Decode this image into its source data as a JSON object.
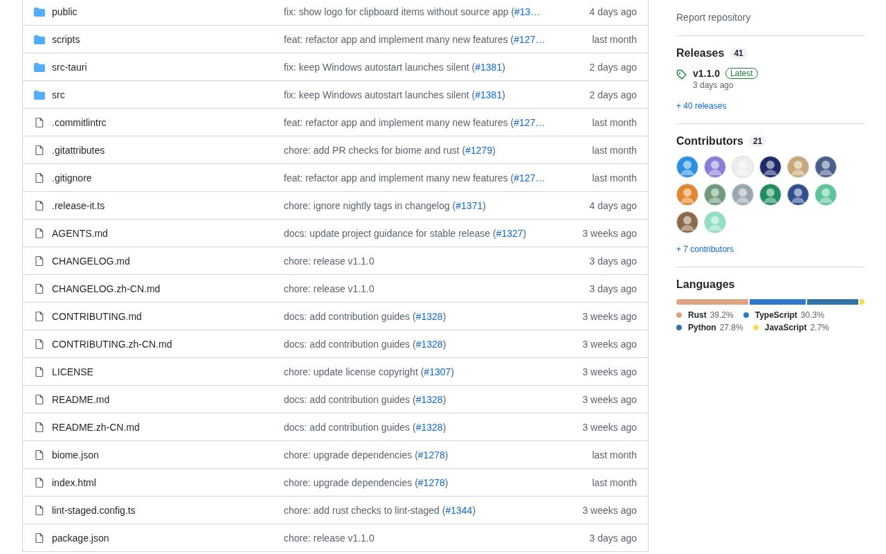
{
  "files": [
    {
      "kind": "folder",
      "name": "public",
      "msg": "fix: show logo for clipboard items without source app (",
      "pr": "#13…",
      "time": "4 days ago"
    },
    {
      "kind": "folder",
      "name": "scripts",
      "msg": "feat: refactor app and implement many new features (",
      "pr": "#127…",
      "time": "last month"
    },
    {
      "kind": "folder",
      "name": "src-tauri",
      "msg": "fix: keep Windows autostart launches silent (",
      "pr": "#1381",
      "tail": ")",
      "time": "2 days ago"
    },
    {
      "kind": "folder",
      "name": "src",
      "msg": "fix: keep Windows autostart launches silent (",
      "pr": "#1381",
      "tail": ")",
      "time": "2 days ago"
    },
    {
      "kind": "file",
      "name": ".commitlintrc",
      "msg": "feat: refactor app and implement many new features (",
      "pr": "#127…",
      "time": "last month"
    },
    {
      "kind": "file",
      "name": ".gitattributes",
      "msg": "chore: add PR checks for biome and rust (",
      "pr": "#1279",
      "tail": ")",
      "time": "last month"
    },
    {
      "kind": "file",
      "name": ".gitignore",
      "msg": "feat: refactor app and implement many new features (",
      "pr": "#127…",
      "time": "last month"
    },
    {
      "kind": "file",
      "name": ".release-it.ts",
      "msg": "chore: ignore nightly tags in changelog (",
      "pr": "#1371",
      "tail": ")",
      "time": "4 days ago"
    },
    {
      "kind": "file",
      "name": "AGENTS.md",
      "msg": "docs: update project guidance for stable release (",
      "pr": "#1327",
      "tail": ")",
      "time": "3 weeks ago"
    },
    {
      "kind": "file",
      "name": "CHANGELOG.md",
      "msg": "chore: release v1.1.0",
      "time": "3 days ago"
    },
    {
      "kind": "file",
      "name": "CHANGELOG.zh-CN.md",
      "msg": "chore: release v1.1.0",
      "time": "3 days ago"
    },
    {
      "kind": "file",
      "name": "CONTRIBUTING.md",
      "msg": "docs: add contribution guides (",
      "pr": "#1328",
      "tail": ")",
      "time": "3 weeks ago"
    },
    {
      "kind": "file",
      "name": "CONTRIBUTING.zh-CN.md",
      "msg": "docs: add contribution guides (",
      "pr": "#1328",
      "tail": ")",
      "time": "3 weeks ago"
    },
    {
      "kind": "file",
      "name": "LICENSE",
      "msg": "chore: update license copyright (",
      "pr": "#1307",
      "tail": ")",
      "time": "3 weeks ago"
    },
    {
      "kind": "file",
      "name": "README.md",
      "msg": "docs: add contribution guides (",
      "pr": "#1328",
      "tail": ")",
      "time": "3 weeks ago"
    },
    {
      "kind": "file",
      "name": "README.zh-CN.md",
      "msg": "docs: add contribution guides (",
      "pr": "#1328",
      "tail": ")",
      "time": "3 weeks ago"
    },
    {
      "kind": "file",
      "name": "biome.json",
      "msg": "chore: upgrade dependencies (",
      "pr": "#1278",
      "tail": ")",
      "time": "last month"
    },
    {
      "kind": "file",
      "name": "index.html",
      "msg": "chore: upgrade dependencies (",
      "pr": "#1278",
      "tail": ")",
      "time": "last month"
    },
    {
      "kind": "file",
      "name": "lint-staged.config.ts",
      "msg": "chore: add rust checks to lint-staged (",
      "pr": "#1344",
      "tail": ")",
      "time": "3 weeks ago"
    },
    {
      "kind": "file",
      "name": "package.json",
      "msg": "chore: release v1.1.0",
      "time": "3 days ago"
    }
  ],
  "sidebar": {
    "report": "Report repository",
    "releases": {
      "title": "Releases",
      "count": "41",
      "tag": "v1.1.0",
      "badge": "Latest",
      "time": "3 days ago",
      "more": "+ 40 releases"
    },
    "contributors": {
      "title": "Contributors",
      "count": "21",
      "more": "+ 7 contributors"
    },
    "languages": {
      "title": "Languages",
      "items": [
        {
          "name": "Rust",
          "percent": "39.2%",
          "color": "#dea584"
        },
        {
          "name": "TypeScript",
          "percent": "30.3%",
          "color": "#3178c6"
        },
        {
          "name": "Python",
          "percent": "27.8%",
          "color": "#3572a5"
        },
        {
          "name": "JavaScript",
          "percent": "2.7%",
          "color": "#f1e05a"
        }
      ]
    }
  }
}
